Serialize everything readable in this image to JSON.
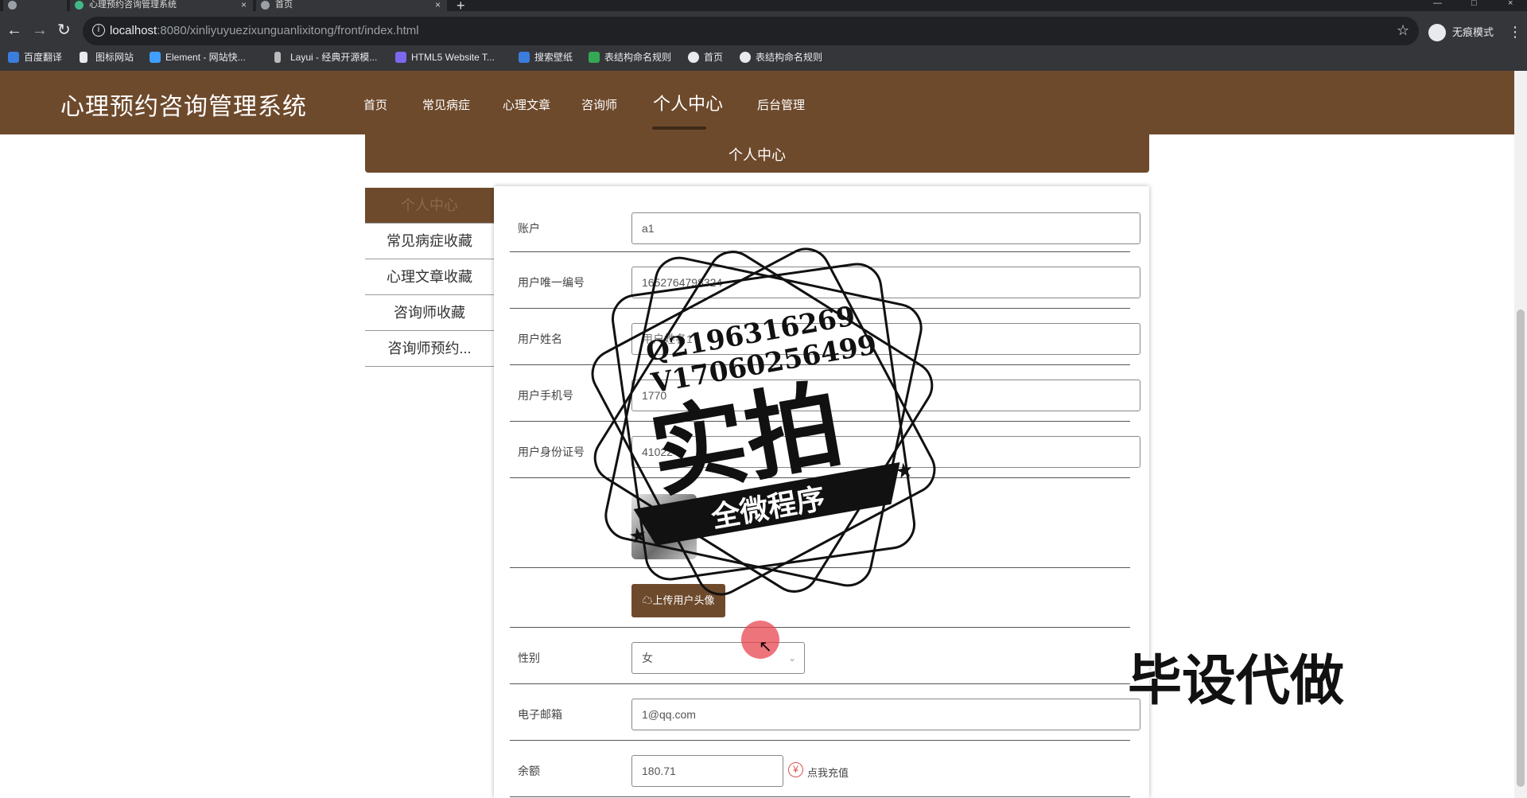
{
  "browser": {
    "tabs": [
      {
        "title": "心理预约咨询管理系统"
      },
      {
        "title": "首页"
      }
    ],
    "url_host": "localhost",
    "url_path": ":8080/xinliyuyuezixunguanlixitong/front/index.html",
    "incognito_label": "无痕模式",
    "bookmarks": [
      "百度翻译",
      "图标网站",
      "Element - 网站快...",
      "Layui - 经典开源模...",
      "HTML5 Website T...",
      "搜索壁纸",
      "表结构命名规则",
      "首页",
      "表结构命名规则"
    ]
  },
  "header": {
    "logo": "心理预约咨询管理系统",
    "nav": [
      "首页",
      "常见病症",
      "心理文章",
      "咨询师",
      "个人中心",
      "后台管理"
    ]
  },
  "banner": {
    "title": "个人中心"
  },
  "side_menu": {
    "items": [
      "个人中心",
      "常见病症收藏",
      "心理文章收藏",
      "咨询师收藏",
      "咨询师预约..."
    ]
  },
  "form": {
    "account": {
      "label": "账户",
      "value": "a1"
    },
    "uid": {
      "label": "用户唯一编号",
      "value": "1652764798324"
    },
    "name": {
      "label": "用户姓名",
      "value": "用户姓名1"
    },
    "phone": {
      "label": "用户手机号",
      "value": "1770"
    },
    "idcard": {
      "label": "用户身份证号",
      "value": "410224"
    },
    "upload_label": "上传用户头像",
    "gender": {
      "label": "性别",
      "value": "女"
    },
    "email": {
      "label": "电子邮箱",
      "value": "1@qq.com"
    },
    "balance": {
      "label": "余额",
      "value": "180.71",
      "recharge": "点我充值"
    }
  },
  "watermark": {
    "line1": "Q2196316269",
    "line2": "V17060256499",
    "big": "实拍",
    "ribbon": "全微程序",
    "corner": "毕设代做"
  },
  "colors": {
    "brand": "#6e4a2c",
    "chrome_dark": "#202124",
    "chrome": "#35363a",
    "recharge_icon": "#d9534f"
  }
}
